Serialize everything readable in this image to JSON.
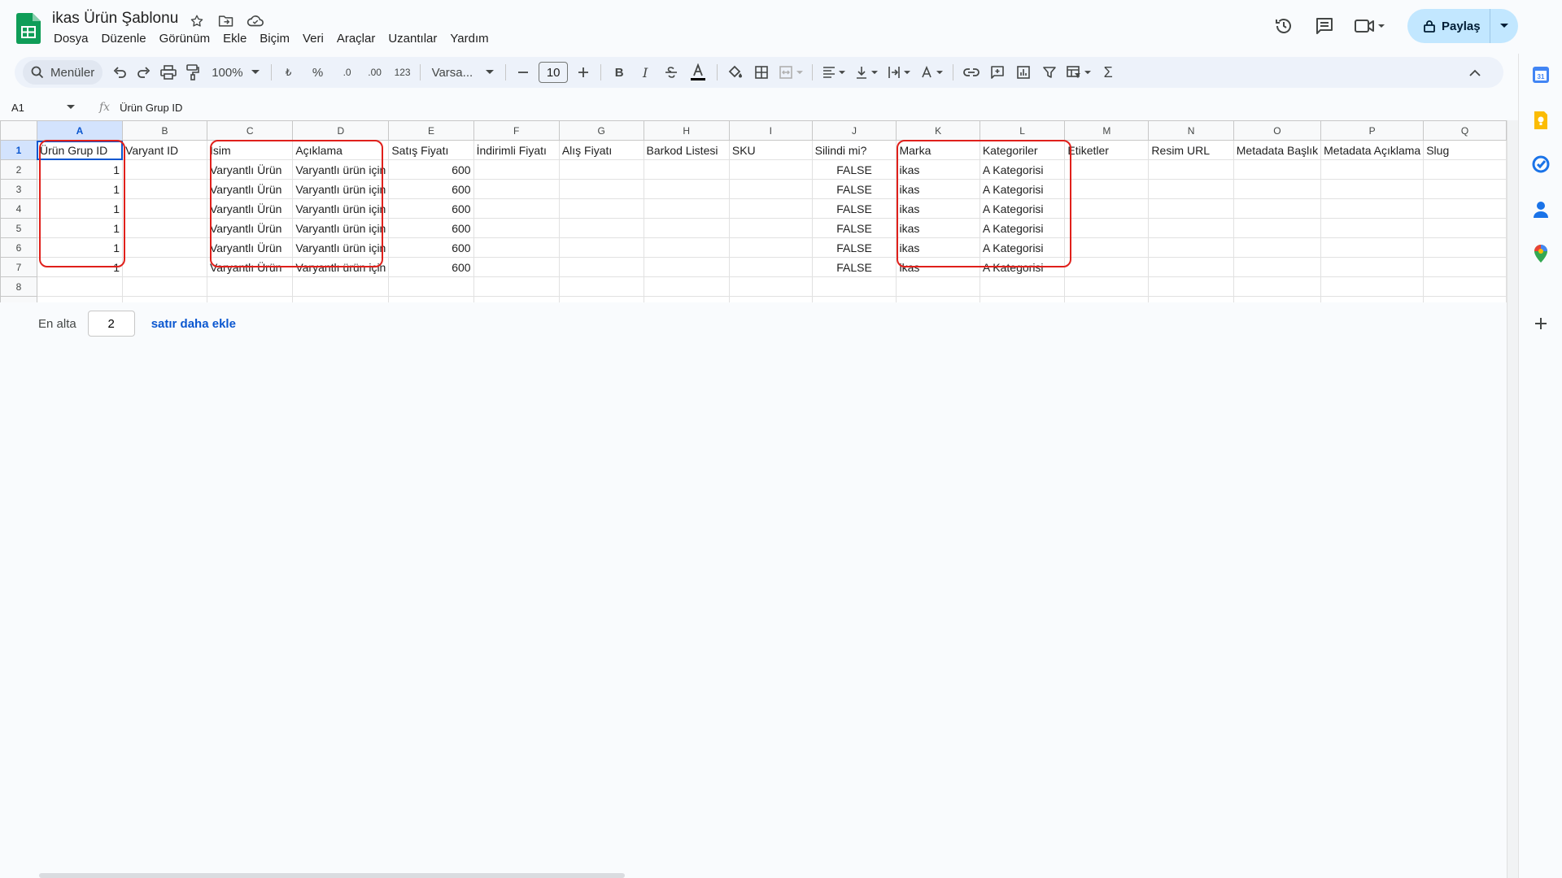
{
  "doc": {
    "title": "ikas Ürün Şablonu"
  },
  "menu": [
    "Dosya",
    "Düzenle",
    "Görünüm",
    "Ekle",
    "Biçim",
    "Veri",
    "Araçlar",
    "Uzantılar",
    "Yardım"
  ],
  "header": {
    "share_label": "Paylaş"
  },
  "toolbar": {
    "search_label": "Menüler",
    "zoom": "100%",
    "currency": "₺",
    "percent": "%",
    "dec_decrease": ".0",
    "dec_increase": ".00",
    "format_123": "123",
    "font_name": "Varsa...",
    "font_size": "10"
  },
  "formula": {
    "cell_ref": "A1",
    "fx": "fx",
    "value": "Ürün Grup ID"
  },
  "grid": {
    "columns": [
      "A",
      "B",
      "C",
      "D",
      "E",
      "F",
      "G",
      "H",
      "I",
      "J",
      "K",
      "L",
      "M",
      "N",
      "O",
      "P",
      "Q"
    ],
    "rows": [
      [
        "Ürün Grup ID",
        "Varyant ID",
        "İsim",
        "Açıklama",
        "Satış Fiyatı",
        "İndirimli Fiyatı",
        "Alış Fiyatı",
        "Barkod Listesi",
        "SKU",
        "Silindi mi?",
        "Marka",
        "Kategoriler",
        "Etiketler",
        "Resim URL",
        "Metadata Başlık",
        "Metadata Açıklama",
        "Slug"
      ],
      [
        "1",
        "",
        "Varyantlı Ürün",
        "Varyantlı ürün için",
        "600",
        "",
        "",
        "",
        "",
        "FALSE",
        "ikas",
        "A Kategorisi",
        "",
        "",
        "",
        "",
        ""
      ],
      [
        "1",
        "",
        "Varyantlı Ürün",
        "Varyantlı ürün için",
        "600",
        "",
        "",
        "",
        "",
        "FALSE",
        "ikas",
        "A Kategorisi",
        "",
        "",
        "",
        "",
        ""
      ],
      [
        "1",
        "",
        "Varyantlı Ürün",
        "Varyantlı ürün için",
        "600",
        "",
        "",
        "",
        "",
        "FALSE",
        "ikas",
        "A Kategorisi",
        "",
        "",
        "",
        "",
        ""
      ],
      [
        "1",
        "",
        "Varyantlı Ürün",
        "Varyantlı ürün için",
        "600",
        "",
        "",
        "",
        "",
        "FALSE",
        "ikas",
        "A Kategorisi",
        "",
        "",
        "",
        "",
        ""
      ],
      [
        "1",
        "",
        "Varyantlı Ürün",
        "Varyantlı ürün için",
        "600",
        "",
        "",
        "",
        "",
        "FALSE",
        "ikas",
        "A Kategorisi",
        "",
        "",
        "",
        "",
        ""
      ],
      [
        "1",
        "",
        "Varyantlı Ürün",
        "Varyantlı ürün için",
        "600",
        "",
        "",
        "",
        "",
        "FALSE",
        "ikas",
        "A Kategorisi",
        "",
        "",
        "",
        "",
        ""
      ],
      [
        "",
        "",
        "",
        "",
        "",
        "",
        "",
        "",
        "",
        "",
        "",
        "",
        "",
        "",
        "",
        "",
        ""
      ],
      [
        "",
        "",
        "",
        "",
        "",
        "",
        "",
        "",
        "",
        "",
        "",
        "",
        "",
        "",
        "",
        "",
        ""
      ]
    ]
  },
  "add_rows": {
    "prefix": "En alta",
    "count": "2",
    "action": "satır daha ekle"
  },
  "colors": {
    "highlight": "#e0201b",
    "accent": "#0b57d0",
    "sheets_green": "#0f9d58"
  }
}
